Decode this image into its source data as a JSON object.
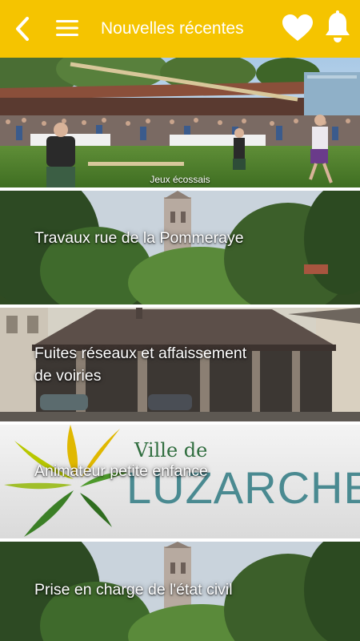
{
  "header": {
    "title": "Nouvelles récentes",
    "background": "#f5c400",
    "icons": [
      "back-arrow-icon",
      "hamburger-menu-icon",
      "heart-icon",
      "bell-icon"
    ]
  },
  "feed": {
    "hero": {
      "caption": "Jeux écossais"
    },
    "items": [
      {
        "title": "Travaux rue de la Pommeraye"
      },
      {
        "title": "Fuites réseaux et affaissement de voiries"
      },
      {
        "title": "Animateur petite enfance",
        "logo": {
          "top": "Ville de",
          "name": "LUZARCHES"
        }
      },
      {
        "title": "Prise en charge de l'état civil"
      }
    ]
  }
}
